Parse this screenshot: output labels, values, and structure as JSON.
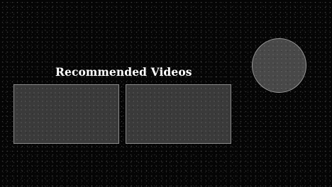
{
  "recommended": {
    "title": "Recommended Videos",
    "videos": [
      {
        "label": ""
      },
      {
        "label": ""
      }
    ]
  },
  "colors": {
    "background": "#050505",
    "thumbnail_fill": "#3a3a3a",
    "thumbnail_border": "#8c8c8c",
    "circle_fill": "#484848",
    "title_text": "#ffffff"
  }
}
